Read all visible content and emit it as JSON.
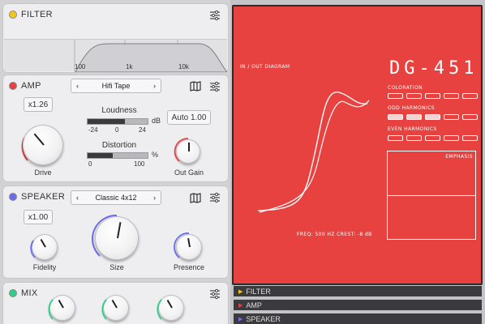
{
  "filter": {
    "title": "FILTER",
    "dot_color": "#f5c61a",
    "ticks": [
      "100",
      "1k",
      "10k"
    ]
  },
  "amp": {
    "title": "AMP",
    "dot_color": "#e74040",
    "multiplier": "x1.26",
    "model": "Hifi Tape",
    "loudness_label": "Loudness",
    "loudness_unit": "dB",
    "loudness_scale": [
      "-24",
      "0",
      "24"
    ],
    "loudness_level": 0.62,
    "distortion_label": "Distortion",
    "distortion_unit": "%",
    "distortion_scale": [
      "0",
      "100"
    ],
    "distortion_level": 0.42,
    "auto_label": "Auto 1.00",
    "drive_label": "Drive",
    "outgain_label": "Out Gain"
  },
  "speaker": {
    "title": "SPEAKER",
    "dot_color": "#6b6cf0",
    "multiplier": "x1.00",
    "model": "Classic 4x12",
    "fidelity_label": "Fidelity",
    "size_label": "Size",
    "presence_label": "Presence"
  },
  "mix": {
    "title": "MIX",
    "dot_color": "#2ecf8a"
  },
  "display": {
    "brand": "DG-451",
    "io_label": "IN / OUT DIAGRAM",
    "coloration_label": "COLORATION",
    "odd_label": "ODD HARMONICS",
    "even_label": "EVEN HARMONICS",
    "emphasis_label": "EMPHASIS",
    "freq_text": "FREQ: 500 HZ   CREST: -8 dB",
    "bg_color": "#e7423f"
  },
  "tabs": [
    {
      "label": "FILTER",
      "color": "#f5c61a"
    },
    {
      "label": "AMP",
      "color": "#e74040"
    },
    {
      "label": "SPEAKER",
      "color": "#6b6cf0"
    }
  ]
}
